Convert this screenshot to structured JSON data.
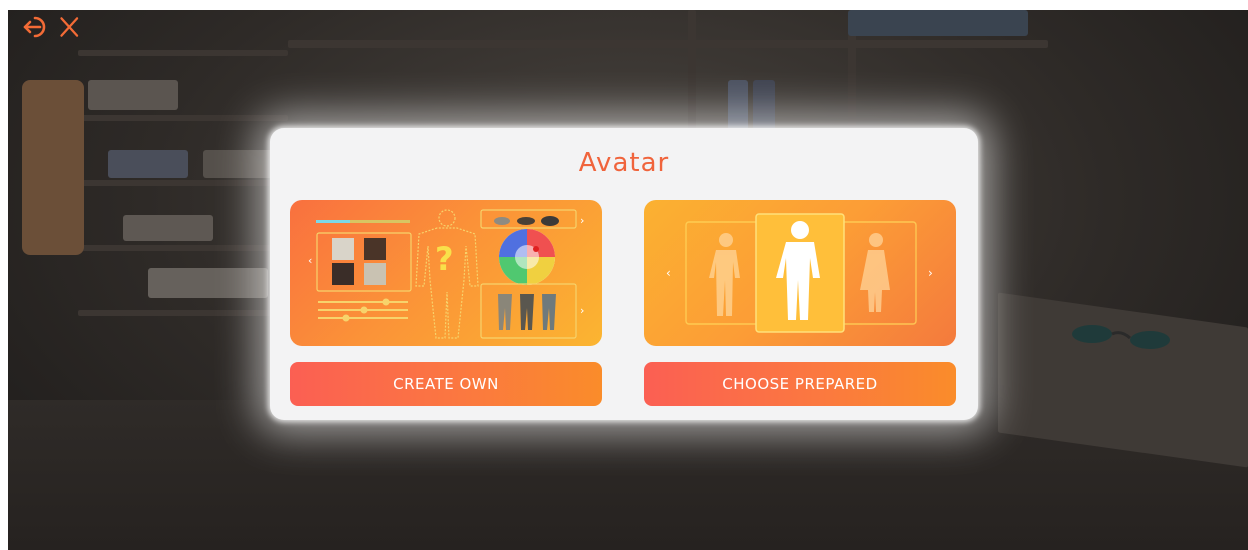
{
  "dialog": {
    "title": "Avatar",
    "create_button_label": "CREATE OWN",
    "prepared_button_label": "CHOOSE PREPARED"
  },
  "toolbar": {
    "icons": [
      "exit-icon",
      "close-icon"
    ]
  },
  "colors": {
    "accent": "#f0643c",
    "button_gradient_start": "#fb5f53",
    "button_gradient_end": "#fa8c2a",
    "dialog_background": "#f3f3f4"
  },
  "create_card": {
    "icons": [
      "color-slider-icon",
      "clothing-grid-icon",
      "body-question-icon",
      "hats-icon",
      "color-wheel-icon",
      "sliders-icon",
      "pants-icon",
      "chevron-left-icon",
      "chevron-right-icon"
    ]
  },
  "prepared_card": {
    "icons": [
      "silhouette-man-left-icon",
      "silhouette-man-center-icon",
      "silhouette-woman-right-icon",
      "chevron-left-icon",
      "chevron-right-icon"
    ]
  }
}
